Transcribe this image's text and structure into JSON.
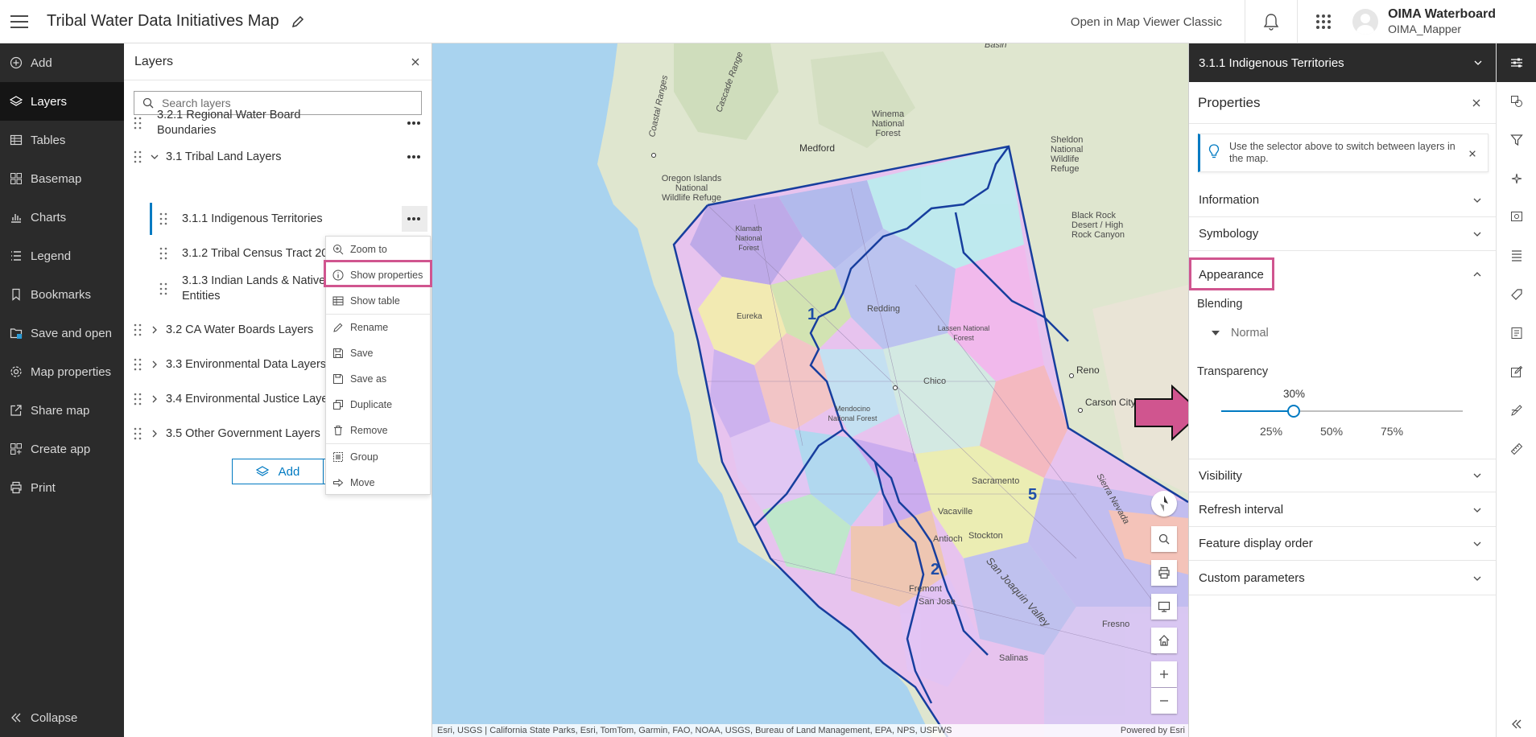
{
  "app": {
    "title": "Tribal Water Data Initiatives Map",
    "open_classic": "Open in Map Viewer Classic",
    "user_name": "OIMA Waterboard",
    "user_sub": "OIMA_Mapper"
  },
  "leftnav": {
    "items": [
      "Add",
      "Layers",
      "Tables",
      "Basemap",
      "Charts",
      "Legend",
      "Bookmarks",
      "Save and open",
      "Map properties",
      "Share map",
      "Create app",
      "Print"
    ],
    "collapse": "Collapse"
  },
  "layers": {
    "title": "Layers",
    "search_placeholder": "Search layers",
    "rows": [
      {
        "l1": "3.2.1 Regional Water Board",
        "l2": "Boundaries"
      },
      {
        "l1": "3.1 Tribal Land Layers"
      },
      {
        "l1": "3.1.1 Indigenous Territories"
      },
      {
        "l1": "3.1.2 Tribal Census Tract 20..."
      },
      {
        "l1": "3.1.3 Indian Lands & Native",
        "l2": "Entities"
      },
      {
        "l1": "3.2 CA Water Boards Layers"
      },
      {
        "l1": "3.3 Environmental Data Layers"
      },
      {
        "l1": "3.4 Environmental Justice Laye..."
      },
      {
        "l1": "3.5 Other Government Layers"
      }
    ],
    "add_label": "Add"
  },
  "context_menu": {
    "items": [
      "Zoom to",
      "Show properties",
      "Show table",
      "Rename",
      "Save",
      "Save as",
      "Duplicate",
      "Remove",
      "Group",
      "Move"
    ]
  },
  "map": {
    "labels": {
      "basin": "Basin",
      "coastal_ranges": "Coastal Ranges",
      "cascade_range": "Cascade Range",
      "winema": "Winema\nNational\nForest",
      "medford": "Medford",
      "oregon_islands": "Oregon Islands\nNational\nWildlife Refuge",
      "sheldon": "Sheldon\nNational\nWildlife\nRefuge",
      "black_rock": "Black Rock\nDesert / High\nRock Canyon",
      "redding": "Redding",
      "lassen": "Lassen National\nForest",
      "chico": "Chico",
      "reno": "Reno",
      "carson_city": "Carson City",
      "eureka": "Eureka",
      "mendocino": "Mendocino\nNational Forest",
      "sacramento": "Sacramento",
      "vacaville": "Vacaville",
      "antioch": "Antioch",
      "stockton": "Stockton",
      "fremont": "Fremont",
      "san_jose": "San Jose",
      "san_joaquin_valley": "San Joaquin Valley",
      "fresno": "Fresno",
      "salinas": "Salinas",
      "sierra_nevada": "Sierra Nevada",
      "klamath": "Klamath\nNational\nForest"
    },
    "region_numbers": [
      "1",
      "5",
      "2"
    ],
    "attribution": "Esri, USGS | California State Parks, Esri, TomTom, Garmin, FAO, NOAA, USGS, Bureau of Land Management, EPA, NPS, USFWS",
    "powered_by": "Powered by Esri"
  },
  "properties": {
    "selector": "3.1.1 Indigenous Territories",
    "title": "Properties",
    "notice": "Use the selector above to switch between layers in the map.",
    "sections": {
      "information": "Information",
      "symbology": "Symbology",
      "appearance": "Appearance",
      "visibility": "Visibility",
      "refresh": "Refresh interval",
      "feature_order": "Feature display order",
      "custom": "Custom parameters"
    },
    "blending_label": "Blending",
    "blending_value": "Normal",
    "transparency_label": "Transparency",
    "transparency_value": "30%",
    "transparency_percent": 30,
    "ticks": [
      "25%",
      "50%",
      "75%"
    ]
  },
  "colors": {
    "accent": "#007ac2",
    "highlight": "#d0558f",
    "nav_bg": "#2b2b2b"
  }
}
